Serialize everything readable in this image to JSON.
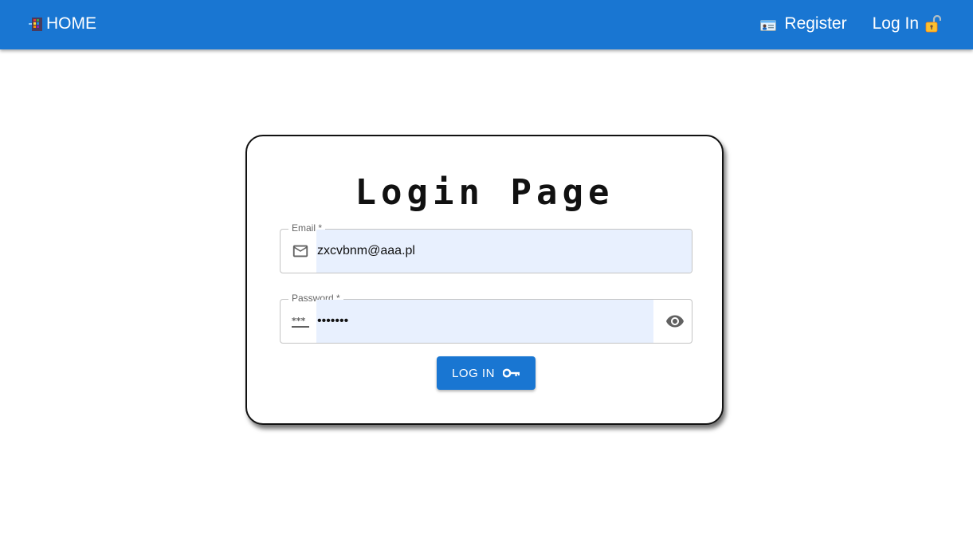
{
  "nav": {
    "home_label": "HOME",
    "register_label": "Register",
    "login_label": "Log In"
  },
  "login": {
    "title": "Login Page",
    "email": {
      "label": "Email *",
      "value": "zxcvbnm@aaa.pl"
    },
    "password": {
      "label": "Password *",
      "value": "•••••••"
    },
    "submit_label": "LOG IN"
  },
  "colors": {
    "appbar": "#1976d2",
    "autofill": "#e8f0fe",
    "button": "#1976d2"
  },
  "icons": {
    "home": "door-icon",
    "register": "id-card-icon",
    "login": "unlocked-lock-icon",
    "email": "mail-outline-icon",
    "password": "password-asterisks-icon",
    "toggle": "eye-icon",
    "submit": "key-icon"
  }
}
